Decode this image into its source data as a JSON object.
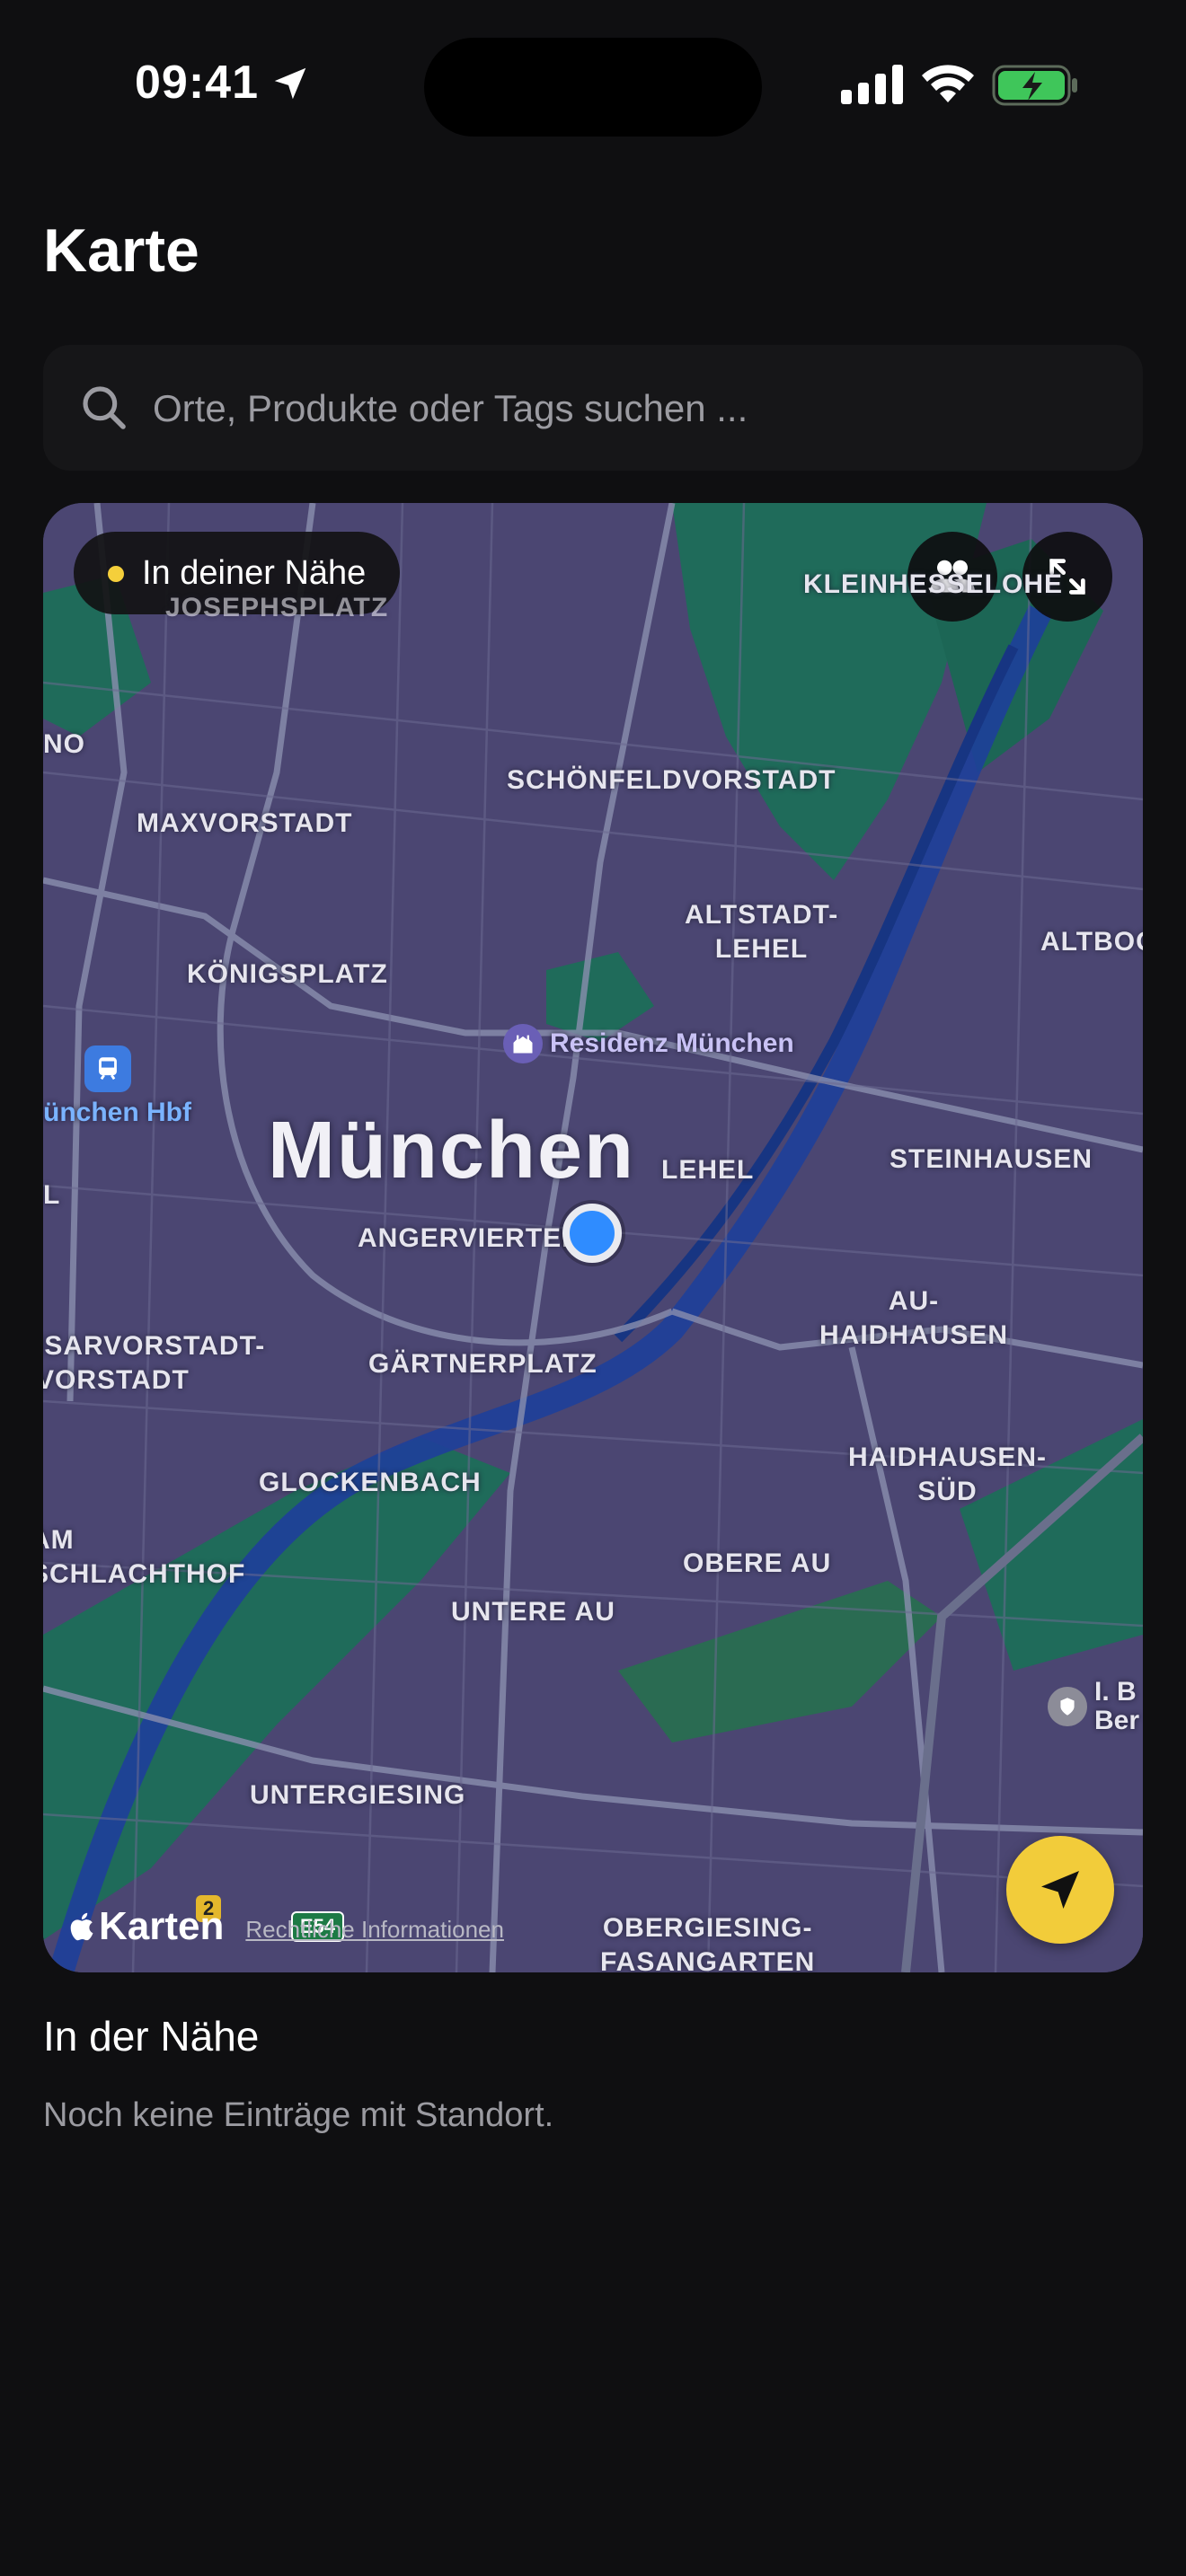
{
  "status_bar": {
    "time": "09:41"
  },
  "page": {
    "title": "Karte"
  },
  "search": {
    "placeholder": "Orte, Produkte oder Tags suchen ..."
  },
  "map": {
    "filter_chip": "In deiner Nähe",
    "city": "München",
    "districts": [
      "KLEINHESSELOHE",
      "NO",
      "SCHÖNFELDVORSTADT",
      "MAXVORSTADT",
      "ALTSTADT-\nLEHEL",
      "ALTBOGENHAUSEN",
      "KÖNIGSPLATZ",
      "LEHEL",
      "STEINHAUSEN",
      "ANGERVIERTEL",
      "AU-\nHAIDHAUSEN",
      "ISARVORSTADT-\nVORSTADT",
      "GÄRTNERPLATZ",
      "HAIDHAUSEN-\nSÜD",
      "GLOCKENBACH",
      "OBERE AU",
      "AM\nSCHLACHTHOF",
      "UNTERE AU",
      "UNTERGIESING",
      "OBERGIESING-\nFASANGARTEN",
      "JOSEPHSPLATZ",
      "L"
    ],
    "pois": {
      "residenz": "Residenz München",
      "hbf": "ünchen Hbf",
      "partial": "I. B\nBer"
    },
    "route_badges": [
      "2",
      "E54"
    ],
    "brand": "Karten",
    "legal": "Rechtliche Informationen"
  },
  "nearby": {
    "title": "In der Nähe",
    "empty": "Noch keine Einträge mit Standort."
  },
  "colors": {
    "background": "#0f0f11",
    "accent": "#f2cc3a",
    "user_location": "#2f8cff"
  }
}
